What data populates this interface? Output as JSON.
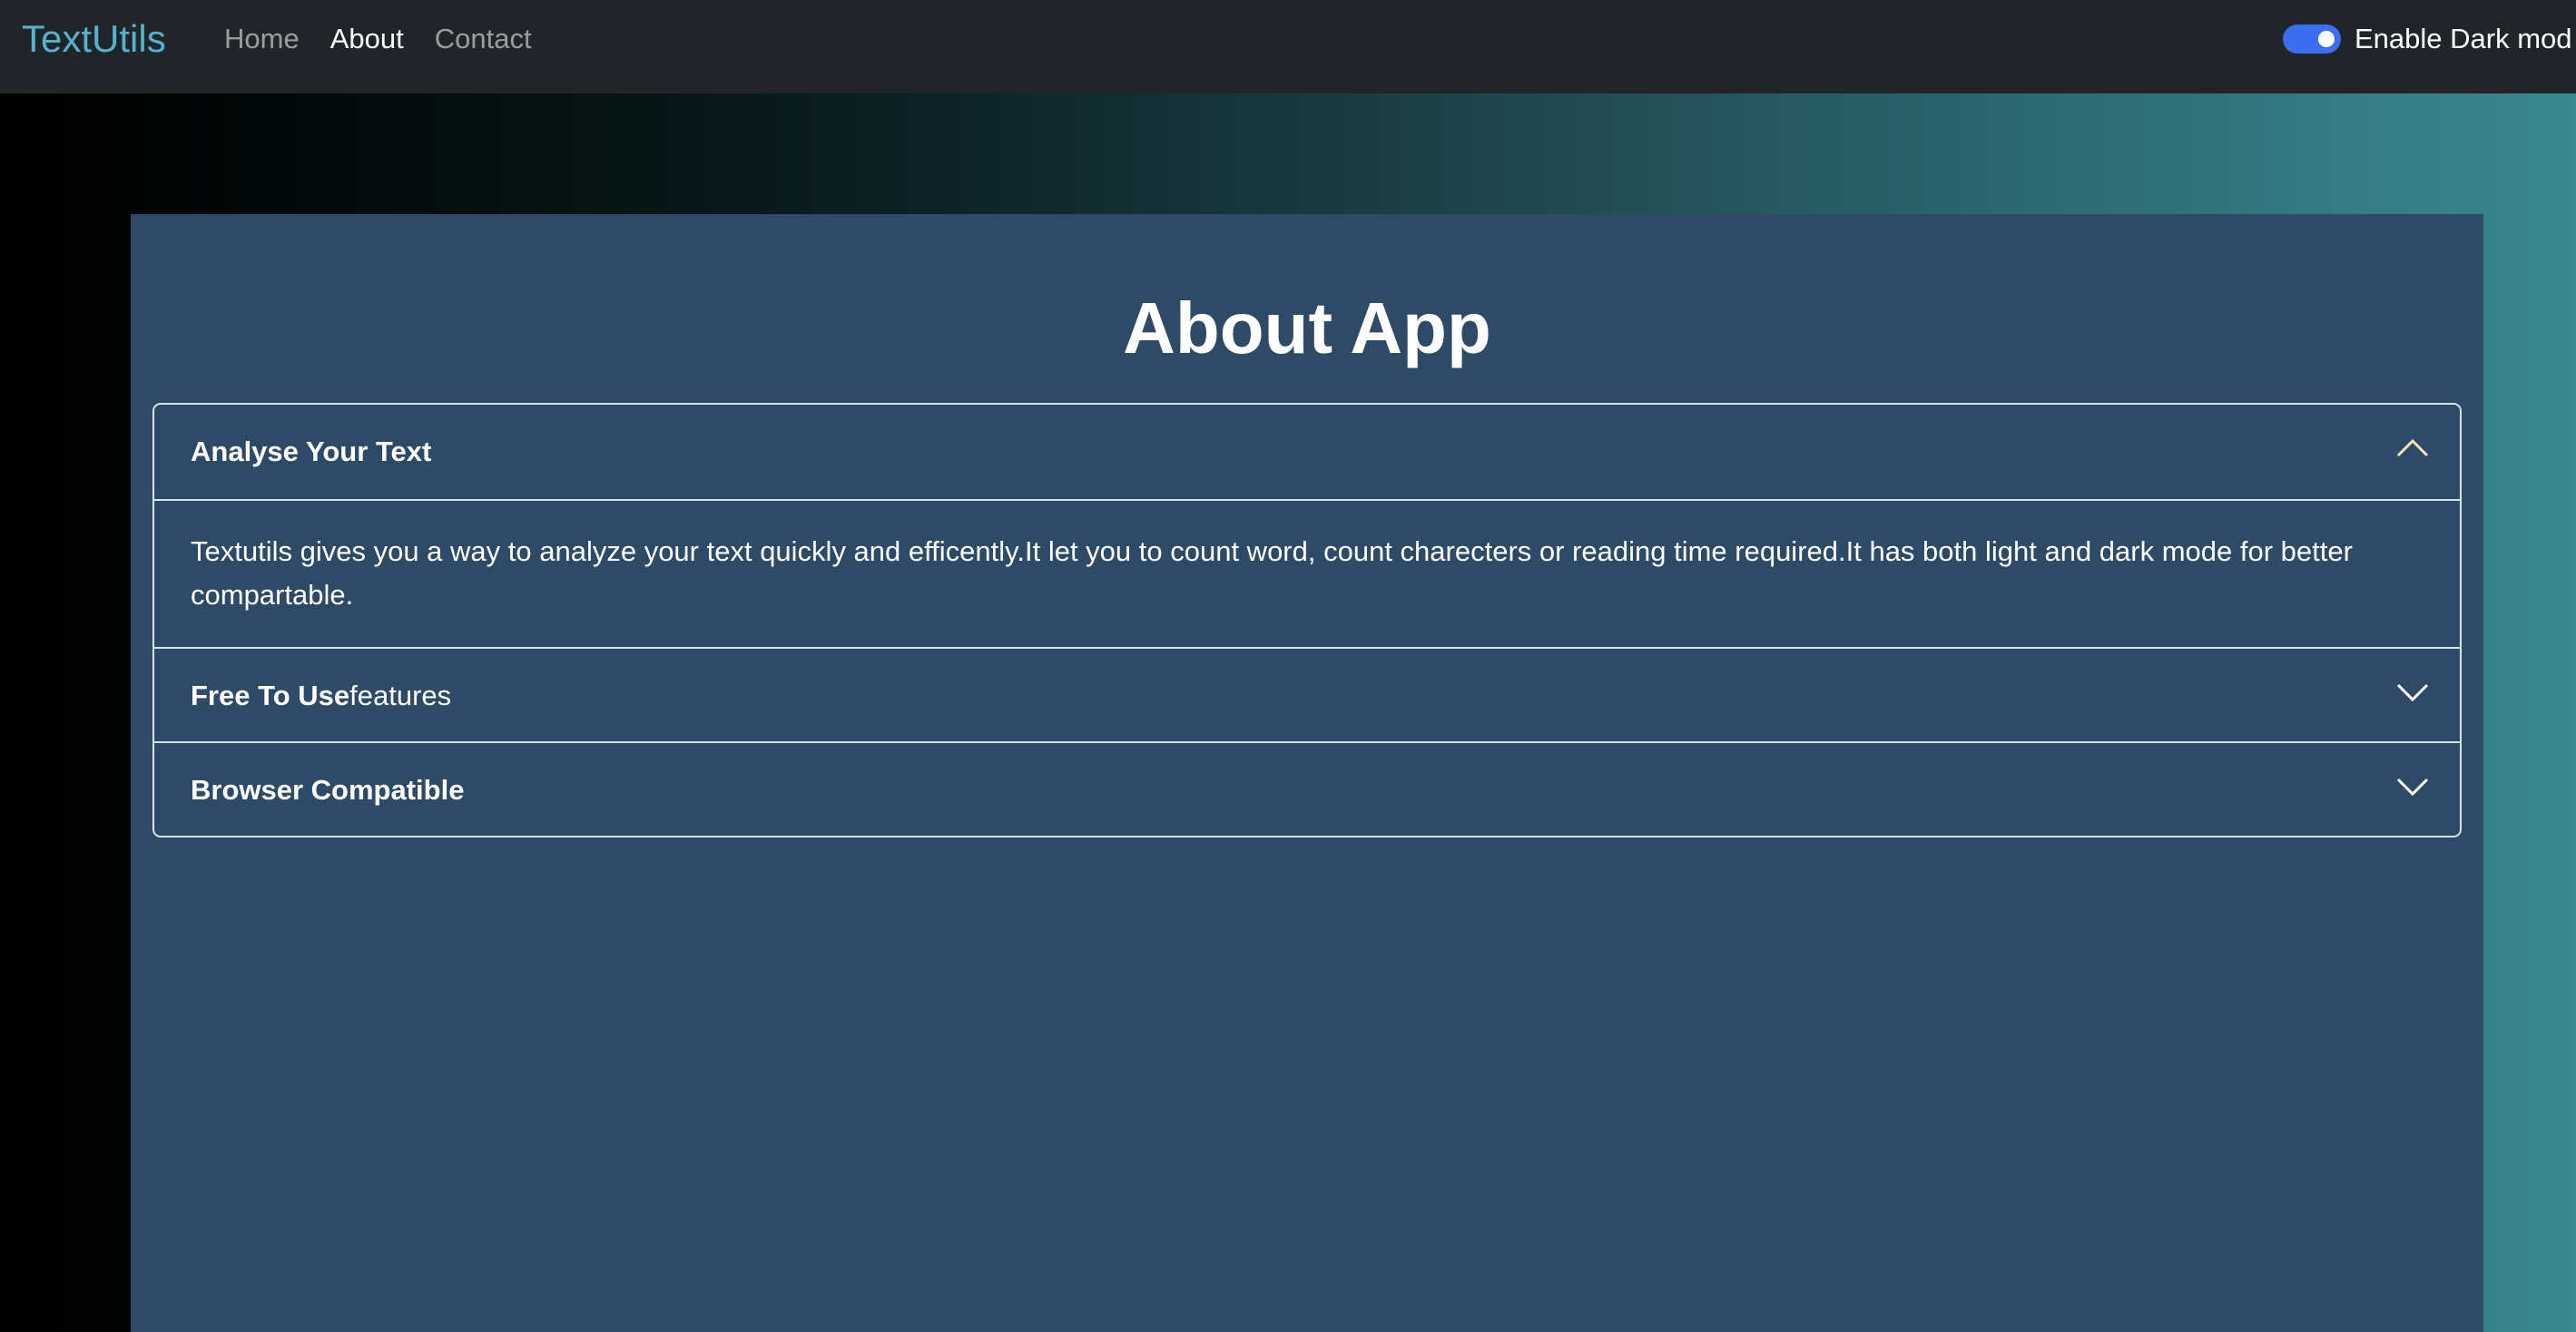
{
  "navbar": {
    "brand": "TextUtils",
    "links": [
      "Home",
      "About",
      "Contact"
    ],
    "active_link": "About",
    "dark_mode_label": "Enable Dark mod",
    "dark_mode_enabled": true
  },
  "main": {
    "title": "About App",
    "accordion": [
      {
        "heading": "Analyse Your Text",
        "heading_suffix": "",
        "expanded": true,
        "body": "Textutils gives you a way to analyze your text quickly and efficently.It let you to count word, count charecters or reading time required.It has both light and dark mode for better compartable."
      },
      {
        "heading": "Free To Use",
        "heading_suffix": "features",
        "expanded": false
      },
      {
        "heading": "Browser Compatible",
        "heading_suffix": "",
        "expanded": false
      }
    ]
  },
  "icons": {
    "expanded": "chevron-up-icon",
    "collapsed": "chevron-down-icon"
  },
  "colors": {
    "brand": "#53b3cb",
    "navbar_bg": "#212529",
    "panel_bg": "#2e4a66",
    "toggle_on": "#3b6ef1",
    "chevron_up": "#f2e6b8"
  }
}
